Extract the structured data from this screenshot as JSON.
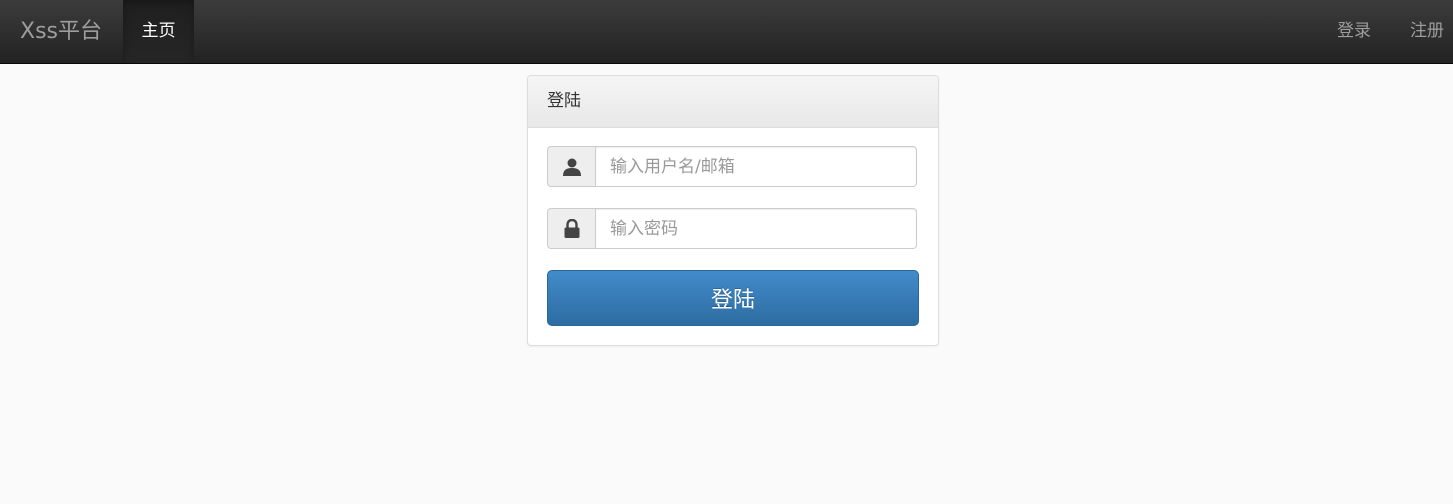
{
  "navbar": {
    "brand": "Xss平台",
    "home_label": "主页",
    "login_label": "登录",
    "register_label": "注册"
  },
  "login_panel": {
    "title": "登陆",
    "username": {
      "value": "",
      "placeholder": "输入用户名/邮箱",
      "icon": "user-icon"
    },
    "password": {
      "value": "",
      "placeholder": "输入密码",
      "icon": "lock-icon"
    },
    "submit_label": "登陆"
  },
  "colors": {
    "navbar_bg": "#222222",
    "primary_button": "#337ab7",
    "page_bg": "#fafafa"
  }
}
